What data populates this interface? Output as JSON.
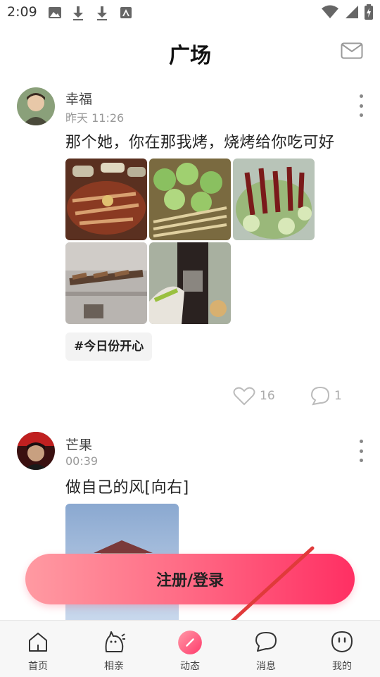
{
  "status_bar": {
    "time": "2:09"
  },
  "header": {
    "title": "广场"
  },
  "posts": [
    {
      "username": "幸福",
      "time": "昨天 11:26",
      "text": "那个她，你在那我烤，烧烤给你吃可好",
      "tag": "#今日份开心",
      "likes": "16",
      "comments": "1"
    },
    {
      "username": "芒果",
      "time": "00:39",
      "text": "做自己的风[向右]"
    }
  ],
  "register": {
    "label": "注册/登录"
  },
  "nav": {
    "items": [
      {
        "label": "首页"
      },
      {
        "label": "相亲"
      },
      {
        "label": "动态"
      },
      {
        "label": "消息"
      },
      {
        "label": "我的"
      }
    ]
  },
  "colors": {
    "accent": "#ff3a6b",
    "arrow": "#e03a3a",
    "muted": "#999999"
  }
}
